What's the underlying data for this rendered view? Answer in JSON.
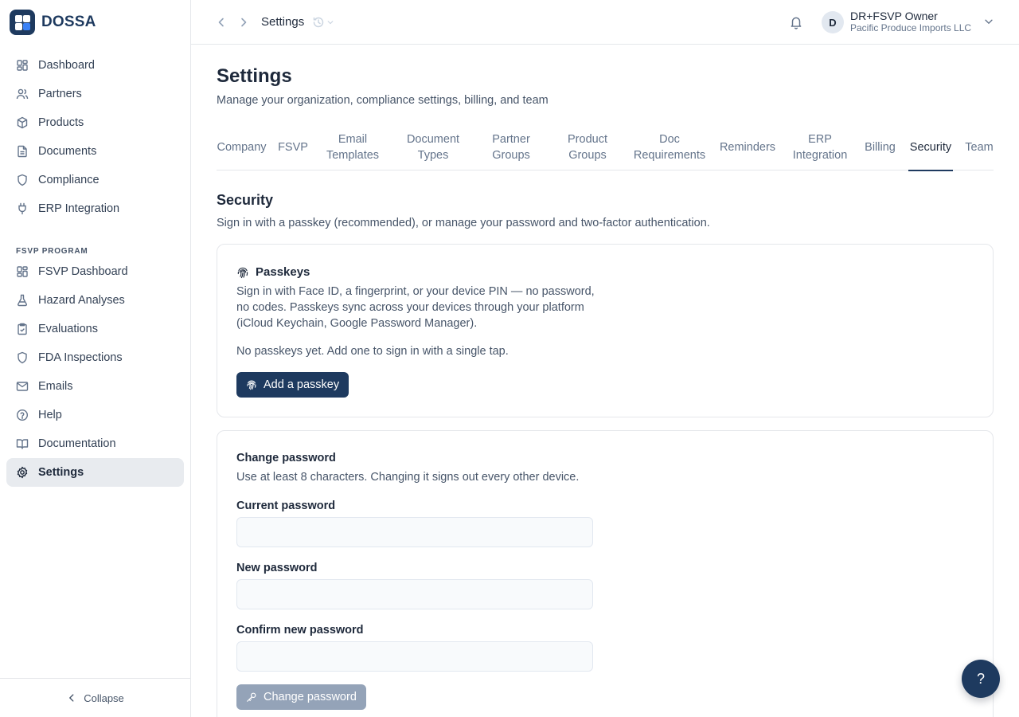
{
  "brand": {
    "name": "DOSSA"
  },
  "sidebar": {
    "items": [
      {
        "label": "Dashboard",
        "icon": "dashboard-icon"
      },
      {
        "label": "Partners",
        "icon": "users-icon"
      },
      {
        "label": "Products",
        "icon": "package-icon"
      },
      {
        "label": "Documents",
        "icon": "file-icon"
      },
      {
        "label": "Compliance",
        "icon": "shield-icon"
      },
      {
        "label": "ERP Integration",
        "icon": "plug-icon"
      }
    ],
    "section_label": "FSVP PROGRAM",
    "fsvp_items": [
      {
        "label": "FSVP Dashboard",
        "icon": "dashboard-icon"
      },
      {
        "label": "Hazard Analyses",
        "icon": "flask-icon"
      },
      {
        "label": "Evaluations",
        "icon": "clipboard-check-icon"
      },
      {
        "label": "FDA Inspections",
        "icon": "shield-icon"
      },
      {
        "label": "Emails",
        "icon": "mail-icon"
      },
      {
        "label": "Help",
        "icon": "help-circle-icon"
      },
      {
        "label": "Documentation",
        "icon": "book-icon"
      },
      {
        "label": "Settings",
        "icon": "gear-icon",
        "active": true
      }
    ],
    "collapse_label": "Collapse"
  },
  "topbar": {
    "title": "Settings",
    "user": {
      "initial": "D",
      "name": "DR+FSVP Owner",
      "org": "Pacific Produce Imports LLC"
    }
  },
  "page": {
    "title": "Settings",
    "subtitle": "Manage your organization, compliance settings, billing, and team"
  },
  "tabs": [
    {
      "line1": "Company",
      "line2": ""
    },
    {
      "line1": "FSVP",
      "line2": ""
    },
    {
      "line1": "Email",
      "line2": "Templates"
    },
    {
      "line1": "Document",
      "line2": "Types"
    },
    {
      "line1": "Partner",
      "line2": "Groups"
    },
    {
      "line1": "Product",
      "line2": "Groups"
    },
    {
      "line1": "Doc",
      "line2": "Requirements"
    },
    {
      "line1": "Reminders",
      "line2": ""
    },
    {
      "line1": "ERP",
      "line2": "Integration"
    },
    {
      "line1": "Billing",
      "line2": ""
    },
    {
      "line1": "Security",
      "line2": "",
      "active": true
    },
    {
      "line1": "Team",
      "line2": ""
    }
  ],
  "security": {
    "title": "Security",
    "subtitle": "Sign in with a passkey (recommended), or manage your password and two-factor authentication.",
    "passkeys": {
      "title": "Passkeys",
      "description": "Sign in with Face ID, a fingerprint, or your device PIN — no password, no codes. Passkeys sync across your devices through your platform (iCloud Keychain, Google Password Manager).",
      "empty_text": "No passkeys yet. Add one to sign in with a single tap.",
      "add_button": "Add a passkey"
    },
    "change_password": {
      "title": "Change password",
      "subtitle": "Use at least 8 characters. Changing it signs out every other device.",
      "current_label": "Current password",
      "current_value": "",
      "new_label": "New password",
      "new_value": "",
      "confirm_label": "Confirm new password",
      "confirm_value": "",
      "submit_button": "Change password"
    }
  },
  "help_fab": {
    "label": "?"
  },
  "colors": {
    "brand": "#1e3a5f",
    "active_nav_bg": "#e8ebef",
    "disabled_button": "#94a3b8"
  }
}
